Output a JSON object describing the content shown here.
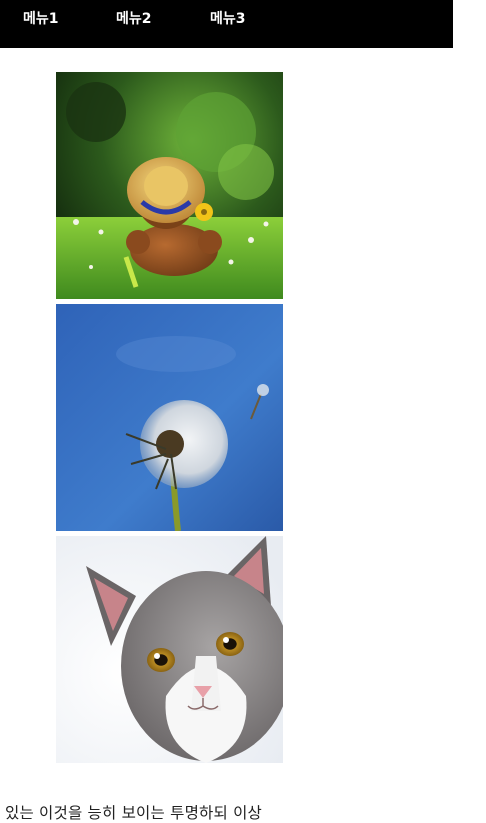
{
  "nav": {
    "items": [
      {
        "label": "메뉴1"
      },
      {
        "label": "메뉴2"
      },
      {
        "label": "메뉴3"
      }
    ]
  },
  "images": [
    {
      "subject": "teddy-bear-straw-hat-on-grass"
    },
    {
      "subject": "dandelion-seed-head-blue-sky"
    },
    {
      "subject": "gray-white-cat-face"
    }
  ],
  "content": {
    "text": "있는 이것을 능히 보이는 투명하되 이상"
  },
  "colors": {
    "nav_bg": "#000000",
    "nav_text": "#ffffff",
    "page_bg": "#ffffff",
    "body_text": "#222222"
  }
}
